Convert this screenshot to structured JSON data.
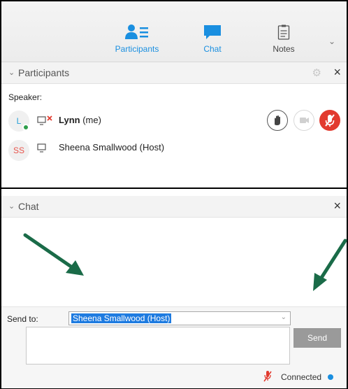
{
  "toolbar": {
    "participants_label": "Participants",
    "chat_label": "Chat",
    "notes_label": "Notes"
  },
  "participants_panel": {
    "title": "Participants",
    "speaker_label": "Speaker:",
    "participants": [
      {
        "initials": "L",
        "name": "Lynn",
        "suffix": "(me)",
        "status": "online"
      },
      {
        "initials": "SS",
        "name": "Sheena Smallwood (Host)"
      }
    ]
  },
  "chat_panel": {
    "title": "Chat",
    "send_to_label": "Send to:",
    "recipient": "Sheena Smallwood (Host)",
    "message_placeholder": "",
    "send_label": "Send",
    "connection_status": "Connected"
  },
  "colors": {
    "accent": "#1a8fe0",
    "mute_red": "#e23a2e",
    "arrow_green": "#1a6b48"
  }
}
